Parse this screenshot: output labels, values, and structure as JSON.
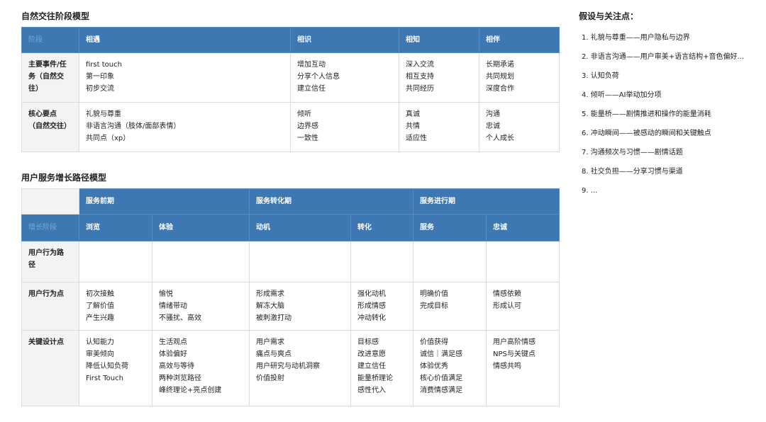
{
  "model1": {
    "title": "自然交往阶段模型",
    "corner": "阶段",
    "stages": [
      "相遇",
      "相识",
      "相知",
      "相伴"
    ],
    "rows": [
      {
        "label": [
          "主要事件/任",
          "务（自然交",
          "往）"
        ],
        "cells": [
          [
            "first touch",
            "第一印象",
            "初步交流"
          ],
          [
            "增加互动",
            "分享个人信息",
            "建立信任"
          ],
          [
            "深入交流",
            "相互支持",
            "共同经历"
          ],
          [
            "长期承诺",
            "共同规划",
            "深度合作"
          ]
        ]
      },
      {
        "label": [
          "核心要点",
          "（自然交往）"
        ],
        "cells": [
          [
            "礼貌与尊重",
            "非语言沟通（肢体/面部表情）",
            "共同点（xp）"
          ],
          [
            "倾听",
            "边界感",
            "一致性"
          ],
          [
            "真诚",
            "共情",
            "适应性"
          ],
          [
            "沟通",
            "忠诚",
            "个人成长"
          ]
        ]
      }
    ]
  },
  "model2": {
    "title": "用户服务增长路径模型",
    "corner": "增长阶段",
    "phases": [
      "服务前期",
      "服务转化期",
      "服务进行期"
    ],
    "stages": [
      "浏览",
      "体验",
      "动机",
      "转化",
      "服务",
      "忠诚"
    ],
    "rows": [
      {
        "label": [
          "用户行为路",
          "径"
        ],
        "cells": [
          [],
          [],
          [],
          [],
          [],
          []
        ]
      },
      {
        "label": [
          "用户行为点"
        ],
        "cells": [
          [
            "初次接触",
            "了解价值",
            "产生兴趣"
          ],
          [
            "愉悦",
            "情绪带动",
            "不骚扰、高效"
          ],
          [
            "形成需求",
            "解冻大脑",
            "被刺激打动"
          ],
          [
            "强化动机",
            "形成情感",
            "冲动转化"
          ],
          [
            "明确价值",
            "完成目标"
          ],
          [
            "情感依赖",
            "形成认可"
          ]
        ]
      },
      {
        "label": [
          "关键设计点"
        ],
        "cells": [
          [
            "认知能力",
            "审美倾向",
            "降低认知负荷",
            "First Touch"
          ],
          [
            "生活观点",
            "体验偏好",
            "高效与等待",
            "两种浏览路径",
            "峰终理论+亮点创建"
          ],
          [
            "用户需求",
            "痛点与爽点",
            "用户研究与动机洞察",
            "价值投射"
          ],
          [
            "目标感",
            "改进意愿",
            "建立信任",
            "能量桥理论",
            "感性代入"
          ],
          [
            "价值获得",
            "诚信｜满足感",
            "体验优秀",
            "核心价值满足",
            "消费情感满足"
          ],
          [
            "用户高阶情感",
            "NPS与关键点",
            "情感共鸣"
          ]
        ]
      }
    ]
  },
  "assumptions": {
    "title": "假设与关注点：",
    "items": [
      "1. 礼貌与尊重——用户隐私与边界",
      "2. 非语言沟通——用户审美+语言结构+音色偏好...",
      "3. 认知负荷",
      "4. 倾听——AI举动加分项",
      "5. 能量桥——剧情推进和操作的能量消耗",
      "6. 冲动瞬间——被感动的瞬间和关键触点",
      "7. 沟通频次与习惯——剧情话题",
      "8. 社交负担——分享习惯与渠道",
      "9. ..."
    ]
  },
  "colors": {
    "header_blue": "#3d78b3",
    "label_bg": "#f3f3f3",
    "border": "#dcdcdc"
  }
}
